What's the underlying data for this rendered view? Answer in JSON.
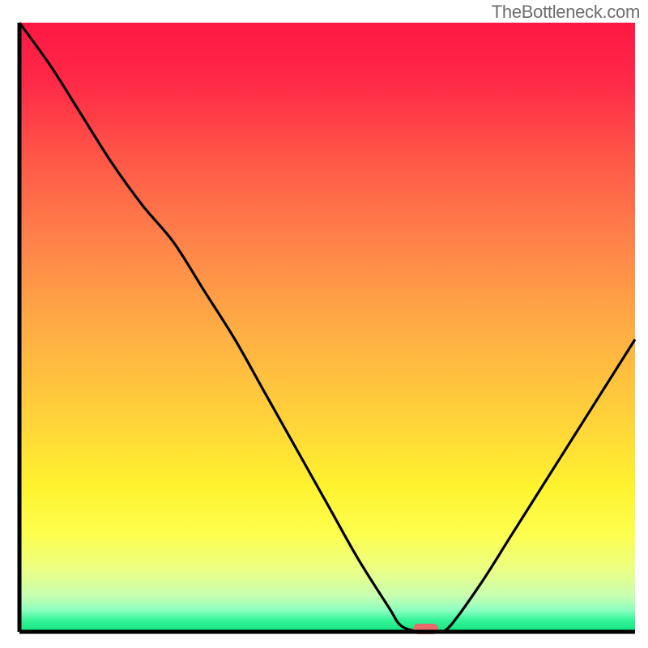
{
  "watermark": "TheBottleneck.com",
  "colors": {
    "axis": "#000000",
    "curve": "#000000",
    "marker": "#e86a6a",
    "gradient_top": "#ff1744",
    "gradient_bottom": "#0fe47d"
  },
  "chart_data": {
    "type": "line",
    "title": "",
    "xlabel": "",
    "ylabel": "",
    "xlim": [
      0,
      100
    ],
    "ylim": [
      0,
      100
    ],
    "x": [
      0,
      5,
      10,
      15,
      20,
      25,
      30,
      35,
      40,
      45,
      50,
      55,
      60,
      62,
      65,
      68,
      70,
      75,
      80,
      85,
      90,
      95,
      100
    ],
    "values": [
      100,
      93,
      85,
      77,
      70,
      64,
      56,
      48,
      39,
      30,
      21,
      12,
      4,
      1,
      0,
      0,
      1,
      8,
      16,
      24,
      32,
      40,
      48
    ],
    "optimal_x": 66,
    "marker": {
      "x_start": 64,
      "x_end": 68,
      "y": 0
    }
  }
}
